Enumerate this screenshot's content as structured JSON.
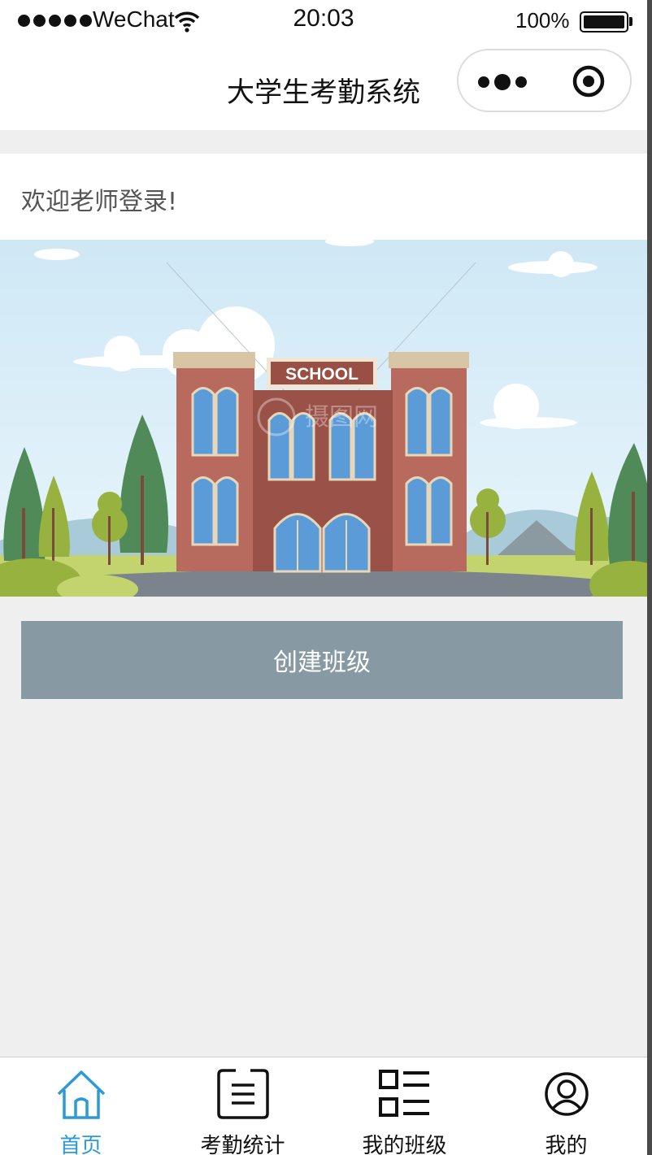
{
  "status_bar": {
    "carrier": "WeChat",
    "time": "20:03",
    "battery": "100%"
  },
  "navbar": {
    "title": "大学生考勤系统",
    "more_icon": "more-dots-icon",
    "close_icon": "target-close-icon"
  },
  "welcome": {
    "text": "欢迎老师登录!"
  },
  "banner": {
    "sign_text": "SCHOOL",
    "watermark": "摄图网"
  },
  "actions": {
    "create_class_label": "创建班级"
  },
  "tabbar": {
    "active_color": "#2c9ad9",
    "items": [
      {
        "label": "首页",
        "icon": "home-icon"
      },
      {
        "label": "考勤统计",
        "icon": "list-doc-icon"
      },
      {
        "label": "我的班级",
        "icon": "grid-list-icon"
      },
      {
        "label": "我的",
        "icon": "user-circle-icon"
      }
    ]
  },
  "colors": {
    "button_bg": "#8799a3",
    "page_bg": "#efefef"
  }
}
